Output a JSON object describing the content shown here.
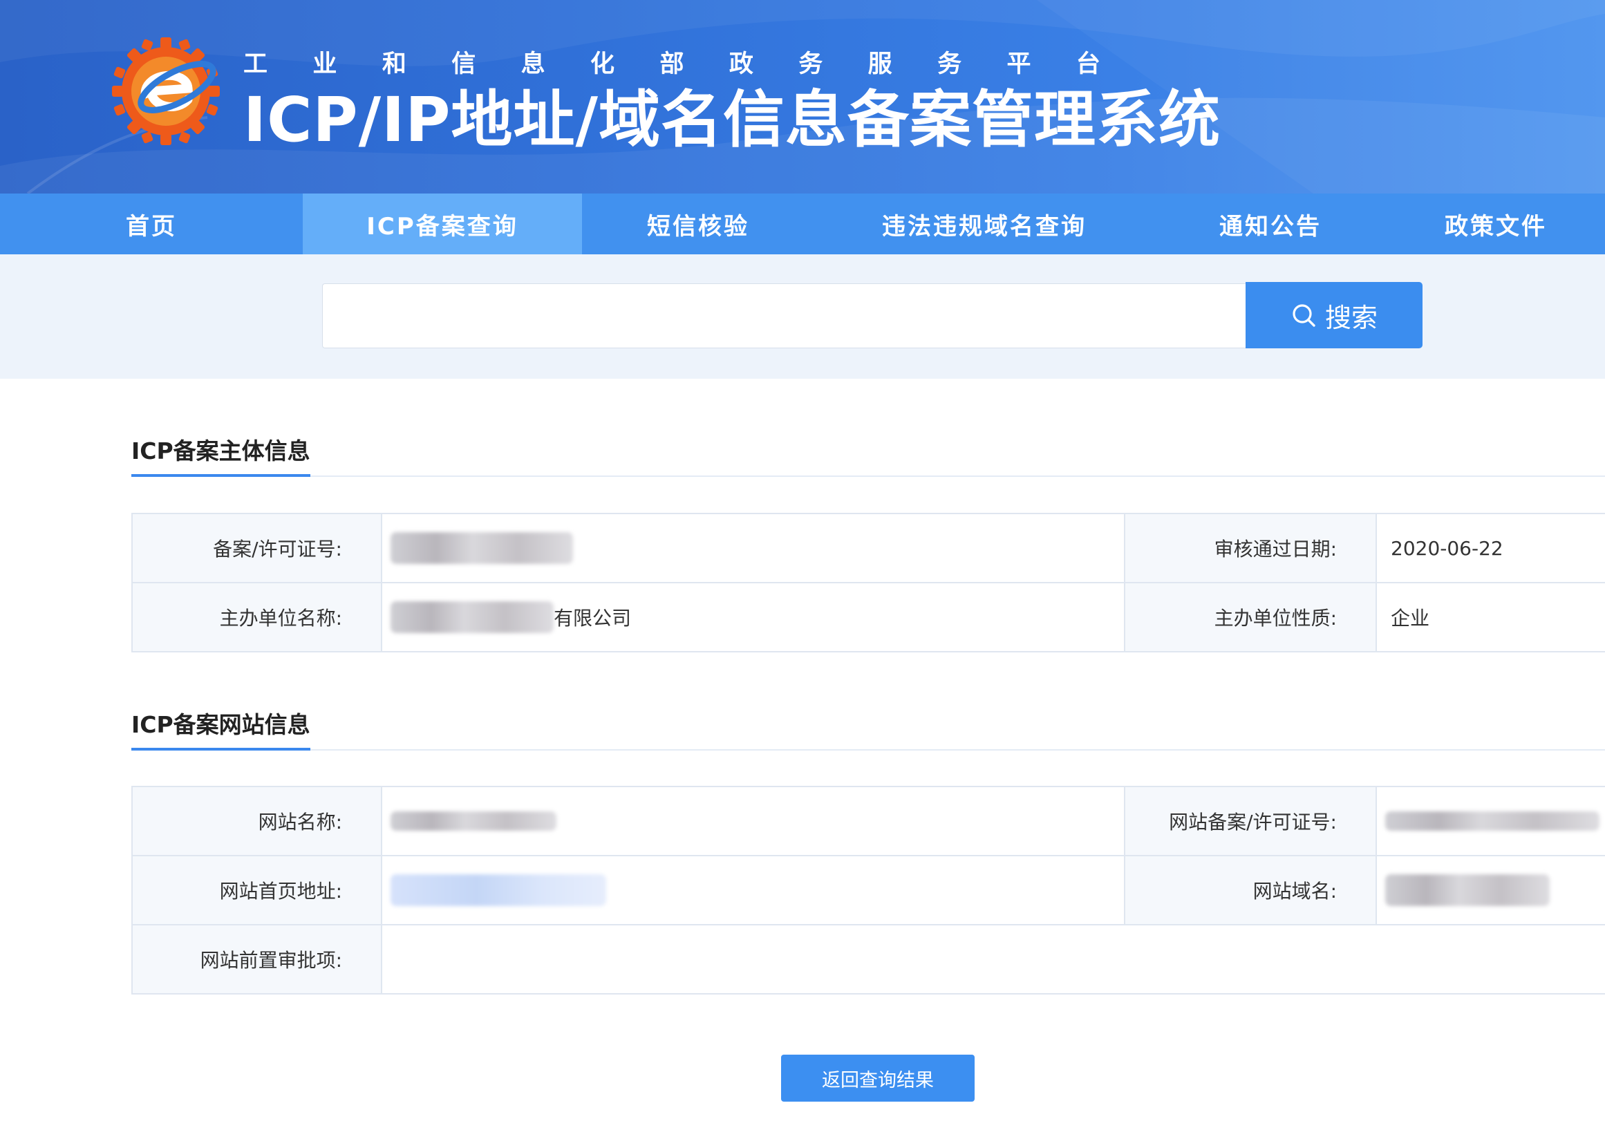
{
  "header": {
    "subtitle_chars": [
      "工",
      "业",
      "和",
      "信",
      "息",
      "化",
      "部",
      "政",
      "务",
      "服",
      "务",
      "平",
      "台"
    ],
    "title": "ICP/IP地址/域名信息备案管理系统",
    "logo_icon": "e-gear-logo-icon"
  },
  "nav": {
    "items": [
      {
        "label": "首页",
        "active": false
      },
      {
        "label": "ICP备案查询",
        "active": true
      },
      {
        "label": "短信核验",
        "active": false
      },
      {
        "label": "违法违规域名查询",
        "active": false
      },
      {
        "label": "通知公告",
        "active": false
      },
      {
        "label": "政策文件",
        "active": false
      }
    ]
  },
  "search": {
    "value": "",
    "placeholder": "",
    "button_label": "搜索",
    "button_icon": "search-icon"
  },
  "subject_info": {
    "title": "ICP备案主体信息",
    "license_no_label": "备案/许可证号:",
    "approval_date_label": "审核通过日期:",
    "approval_date_value": "2020-06-22",
    "org_name_label": "主办单位名称:",
    "org_name_visible_suffix": "有限公司",
    "org_type_label": "主办单位性质:",
    "org_type_value": "企业"
  },
  "website_info": {
    "title": "ICP备案网站信息",
    "site_name_label": "网站名称:",
    "site_license_label": "网站备案/许可证号:",
    "homepage_label": "网站首页地址:",
    "domain_label": "网站域名:",
    "pre_approval_label": "网站前置审批项:",
    "pre_approval_value": ""
  },
  "actions": {
    "return_label": "返回查询结果"
  },
  "colors": {
    "banner": "#3070d8",
    "nav": "#4191ef",
    "nav_active": "#64aef9",
    "accent": "#3b8def",
    "search_band": "#edf3fb",
    "label_bg": "#f5f8fc",
    "border": "#dfe6f0"
  }
}
